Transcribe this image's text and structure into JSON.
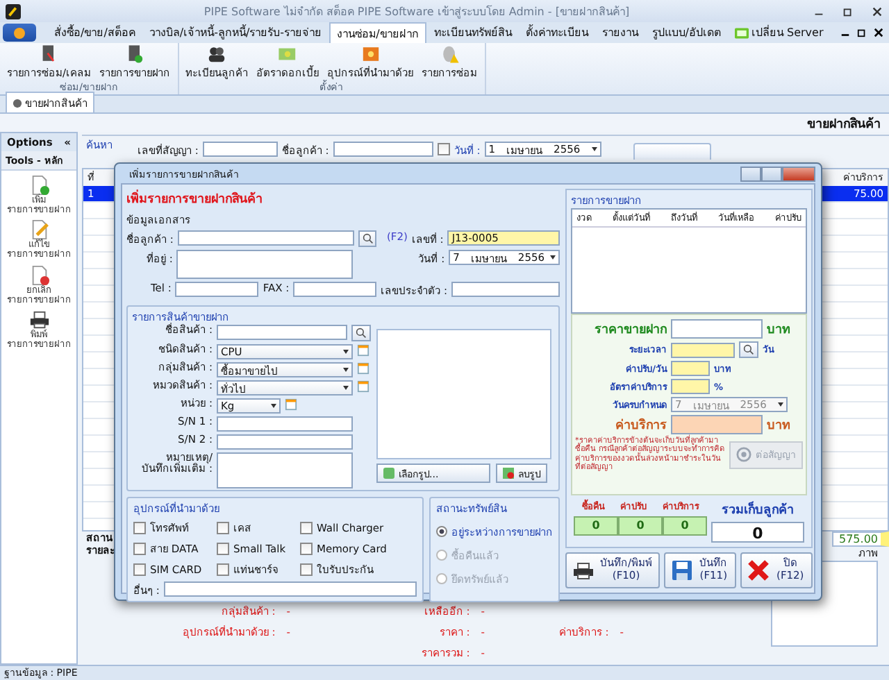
{
  "window": {
    "title": "PIPE Software ไม่จำกัด สต็อค PIPE Software เข้าสู่ระบบโดย Admin - [ขายฝากสินค้า]"
  },
  "menu_tabs": [
    {
      "label": "สั่งซื้อ/ขาย/สต็อค",
      "selected": false,
      "kind": "tab"
    },
    {
      "label": "วางบิล/เจ้าหนี้-ลูกหนี้/รายรับ-รายจ่าย",
      "selected": false,
      "kind": "tab"
    },
    {
      "label": "งานซ่อม/ขายฝาก",
      "selected": true,
      "kind": "tab"
    },
    {
      "label": "ทะเบียนทรัพย์สิน",
      "selected": false,
      "kind": "tab"
    },
    {
      "label": "ตั้งค่าทะเบียน",
      "selected": false,
      "kind": "tab"
    },
    {
      "label": "รายงาน",
      "selected": false,
      "kind": "tab"
    },
    {
      "label": "รูปแบบ/อัปเดต",
      "selected": false,
      "kind": "tab"
    },
    {
      "label": "เปลี่ยน Server",
      "selected": false,
      "kind": "server"
    }
  ],
  "ribbon": {
    "groups": [
      {
        "label": "ซ่อม/ขายฝาก",
        "buttons": [
          {
            "label": "รายการซ่อม/เคลม",
            "kind": "repair-doc"
          },
          {
            "label": "รายการขายฝาก",
            "kind": "sale-doc"
          }
        ]
      },
      {
        "label": "ตั้งค่า",
        "buttons": [
          {
            "label": "ทะเบียนลูกค้า",
            "kind": "people"
          },
          {
            "label": "อัตราดอกเบี้ย",
            "kind": "money"
          },
          {
            "label": "อุปกรณ์ที่นำมาด้วย",
            "kind": "box"
          },
          {
            "label": "รายการซ่อม",
            "kind": "mouse"
          }
        ]
      }
    ]
  },
  "document_tab": {
    "label": "ขายฝากสินค้า"
  },
  "page_header": "ขายฝากสินค้า",
  "sidebar": {
    "title": "Options",
    "collapse": "«",
    "section": "Tools - หลัก",
    "items": [
      {
        "kind": "add",
        "line_1": "เพิ่ม",
        "line_2": "รายการขายฝาก"
      },
      {
        "kind": "edit",
        "line_1": "แก้ไข",
        "line_2": "รายการขายฝาก"
      },
      {
        "kind": "cancel",
        "line_1": "ยกเลิก",
        "line_2": "รายการขายฝาก"
      },
      {
        "kind": "print",
        "line_1": "พิมพ์",
        "line_2": "รายการขายฝาก"
      }
    ]
  },
  "search": {
    "title": "ค้นหา",
    "contract_label": "เลขที่สัญญา :",
    "customer_label": "ชื่อลูกค้า :",
    "date_checked": false,
    "date_label": "วันที่ :",
    "date": {
      "day": "1",
      "month": "เมษายน",
      "year": "2556"
    }
  },
  "table": {
    "first_column": "ที่",
    "last_column": "ค่าบริการ",
    "rows": [
      {
        "number": "1",
        "fee": "75.00",
        "selected": true
      }
    ],
    "total": "575.00",
    "cut_labels": [
      "สถาน",
      "รายละ"
    ]
  },
  "details": {
    "left": [
      {
        "label": "กลุ่มสินค้า :",
        "value": "-"
      },
      {
        "label": "อุปกรณ์ที่นำมาด้วย :",
        "value": "-"
      }
    ],
    "middle": [
      {
        "label": "เหลืออีก :",
        "value": "-"
      },
      {
        "label": "ราคา :",
        "value": "-"
      },
      {
        "label": "ราคารวม :",
        "value": "-"
      }
    ],
    "right": [
      {
        "label": "ค่าบริการ :",
        "value": "-"
      }
    ],
    "picture_label": "ภาพ"
  },
  "status_bar": "ฐานข้อมูล : PIPE",
  "dialog": {
    "title": "เพิ่มรายการขายฝากสินค้า",
    "heading": "เพิ่มรายการขายฝากสินค้า",
    "doc_section": "ข้อมูลเอกสาร",
    "customer_label": "ชื่อลูกค้า :",
    "shortcut": "(F2)",
    "number_label": "เลขที่ :",
    "number": "J13-0005",
    "address_label": "ที่อยู่ :",
    "date_label": "วันที่ :",
    "date": {
      "day": "7",
      "month": "เมษายน",
      "year": "2556"
    },
    "tel_label": "Tel :",
    "fax_label": "FAX :",
    "tax_id_label": "เลขประจำตัว :",
    "product": {
      "title": "รายการสินค้าขายฝาก",
      "fields": [
        {
          "kind": "search",
          "label": "ชื่อสินค้า :"
        },
        {
          "kind": "combo",
          "label": "ชนิดสินค้า :",
          "value": "CPU"
        },
        {
          "kind": "combo",
          "label": "กลุ่มสินค้า :",
          "value": "ซื้อมาขายไป"
        },
        {
          "kind": "combo",
          "label": "หมวดสินค้า :",
          "value": "ทั่วไป"
        },
        {
          "kind": "unit",
          "label": "หน่วย :",
          "value": "Kg"
        },
        {
          "kind": "text",
          "label": "S/N 1 :"
        },
        {
          "kind": "text",
          "label": "S/N 2 :"
        },
        {
          "kind": "memo",
          "label": "หมายเหตุ/\nบันทึกเพิ่มเติม :"
        }
      ]
    },
    "choose_picture": "เลือกรูป...",
    "delete_picture": "ลบรูป",
    "accessories": {
      "title": "อุปกรณ์ที่นำมาด้วย",
      "items": [
        {
          "label": "โทรศัพท์",
          "checked": false
        },
        {
          "label": "เคส",
          "checked": false
        },
        {
          "label": "Wall Charger",
          "checked": false
        },
        {
          "label": "สาย DATA",
          "checked": false
        },
        {
          "label": "Small Talk",
          "checked": false
        },
        {
          "label": "Memory Card",
          "checked": false
        },
        {
          "label": "SIM CARD",
          "checked": false
        },
        {
          "label": "แท่นชาร์จ",
          "checked": false
        },
        {
          "label": "ใบรับประกัน",
          "checked": false
        }
      ],
      "other_label": "อื่นๆ :"
    },
    "status": {
      "title": "สถานะทรัพย์สิน",
      "options": [
        {
          "label": "อยู่ระหว่างการขายฝาก",
          "selected": true,
          "disabled": false
        },
        {
          "label": "ซื้อคืนแล้ว",
          "selected": false,
          "disabled": true
        },
        {
          "label": "ยึดทรัพย์แล้ว",
          "selected": false,
          "disabled": true
        }
      ]
    },
    "schedule": {
      "title": "รายการขายฝาก",
      "columns": [
        "งวด",
        "ตั้งแต่วันที่",
        "ถึงวันที่",
        "วันที่เหลือ",
        "ค่าปรับ"
      ]
    },
    "pricing": {
      "price_label": "ราคาขายฝาก",
      "price_unit": "บาท",
      "period_label": "ระยะเวลา",
      "period_unit": "วัน",
      "fine_label": "ค่าปรับ/วัน",
      "fine_unit": "บาท",
      "rate_label": "อัตราค่าบริการ",
      "rate_unit": "%",
      "due_label": "วันครบกำหนด",
      "due_date": {
        "day": "7",
        "month": "เมษายน",
        "year": "2556"
      },
      "fee_label": "ค่าบริการ",
      "fee_unit": "บาท",
      "note": "*ราคาค่าบริการข้างต้นจะเก็บวันที่ลูกค้ามาซื้อคืน กรณีลูกค้าต่อสัญญาระบบจะทำการคิดค่าบริการของงวดนั้นล่วงหน้ามาชำระในวันที่ต่อสัญญา",
      "renew_button": {
        "label": "ต่อสัญญา",
        "disabled": true
      }
    },
    "totals": {
      "items": [
        {
          "label": "ซื้อคืน",
          "value": "0"
        },
        {
          "label": "ค่าปรับ",
          "value": "0"
        },
        {
          "label": "ค่าบริการ",
          "value": "0"
        }
      ],
      "grand_label": "รวมเก็บลูกค้า",
      "grand_value": "0"
    },
    "buttons": [
      {
        "kind": "save-print",
        "label": "บันทึก/พิมพ์",
        "key": "(F10)"
      },
      {
        "kind": "save",
        "label": "บันทึก",
        "key": "(F11)"
      },
      {
        "kind": "close",
        "label": "ปิด",
        "key": "(F12)"
      }
    ]
  }
}
